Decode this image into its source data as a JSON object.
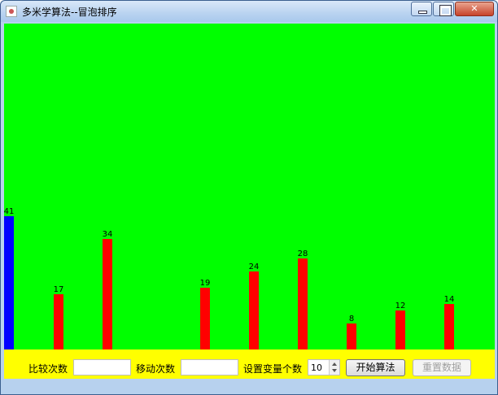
{
  "window": {
    "title": "多米学算法--冒泡排序"
  },
  "chart_data": {
    "type": "bar",
    "values": [
      41,
      17,
      34,
      null,
      19,
      24,
      28,
      8,
      12,
      14
    ],
    "labels": [
      "41",
      "17",
      "34",
      "",
      "19",
      "24",
      "28",
      "8",
      "12",
      "14"
    ],
    "highlight_index": 0,
    "colors": {
      "bar": "#ff0000",
      "highlight": "#0000ff",
      "background": "#00ff00"
    }
  },
  "controls": {
    "compare_label": "比较次数",
    "compare_value": "",
    "move_label": "移动次数",
    "move_value": "",
    "count_label": "设置变量个数",
    "count_value": "10",
    "start_button": "开始算法",
    "reset_button": "重置数据"
  },
  "colors": {
    "controls_bg": "#ffff00"
  }
}
